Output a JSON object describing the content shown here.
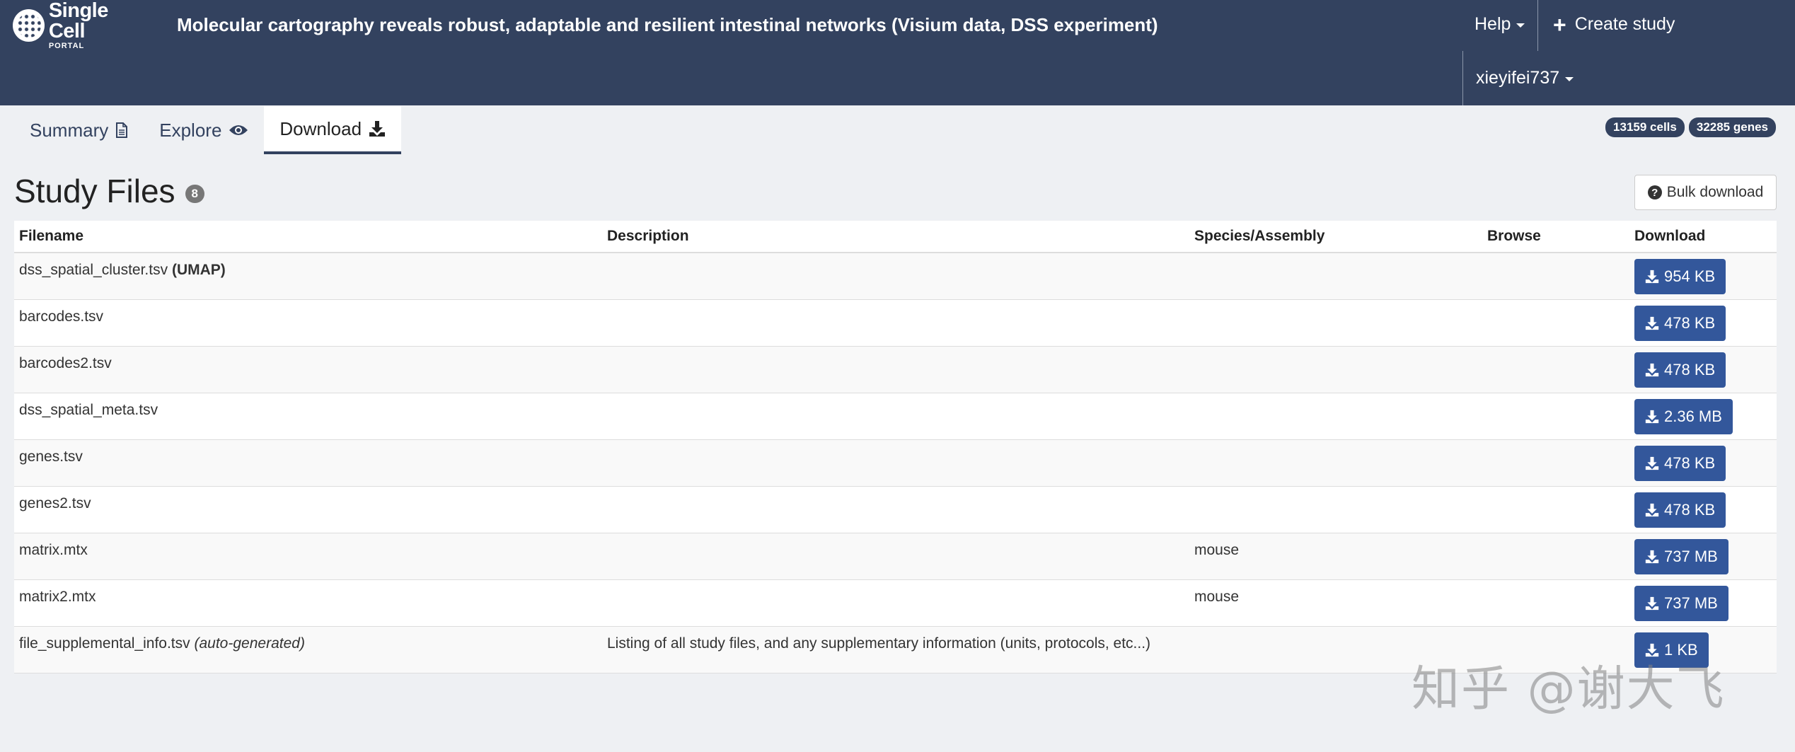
{
  "navbar": {
    "logo_main": "Single Cell",
    "logo_sub": "PORTAL",
    "study_title": "Molecular cartography reveals robust, adaptable and resilient intestinal networks (Visium data, DSS experiment)",
    "help_label": "Help",
    "create_label": "Create study",
    "user_label": "xieyifei737"
  },
  "tabs": [
    {
      "label": "Summary",
      "icon": "file-icon"
    },
    {
      "label": "Explore",
      "icon": "eye-icon"
    },
    {
      "label": "Download",
      "icon": "download-icon",
      "active": true
    }
  ],
  "stats": {
    "cells": "13159 cells",
    "genes": "32285 genes"
  },
  "section": {
    "title": "Study Files",
    "count": "8",
    "bulk_label": "Bulk download"
  },
  "table": {
    "headers": {
      "filename": "Filename",
      "description": "Description",
      "species": "Species/Assembly",
      "browse": "Browse",
      "download": "Download"
    },
    "rows": [
      {
        "filename": "dss_spatial_cluster.tsv",
        "tag": "(UMAP)",
        "description": "",
        "species": "",
        "size": "954 KB"
      },
      {
        "filename": "barcodes.tsv",
        "tag": "",
        "description": "",
        "species": "",
        "size": "478 KB"
      },
      {
        "filename": "barcodes2.tsv",
        "tag": "",
        "description": "",
        "species": "",
        "size": "478 KB"
      },
      {
        "filename": "dss_spatial_meta.tsv",
        "tag": "",
        "description": "",
        "species": "",
        "size": "2.36 MB"
      },
      {
        "filename": "genes.tsv",
        "tag": "",
        "description": "",
        "species": "",
        "size": "478 KB"
      },
      {
        "filename": "genes2.tsv",
        "tag": "",
        "description": "",
        "species": "",
        "size": "478 KB"
      },
      {
        "filename": "matrix.mtx",
        "tag": "",
        "description": "",
        "species": "mouse",
        "size": "737 MB"
      },
      {
        "filename": "matrix2.mtx",
        "tag": "",
        "description": "",
        "species": "mouse",
        "size": "737 MB"
      },
      {
        "filename": "file_supplemental_info.tsv",
        "note": "(auto-generated)",
        "description": "Listing of all study files, and any supplementary information (units, protocols, etc...)",
        "species": "",
        "size": "1 KB"
      }
    ]
  },
  "watermark": "知乎 @谢大飞",
  "colors": {
    "navbar": "#33425f",
    "button": "#33579b",
    "page_bg": "#eef0f3"
  }
}
